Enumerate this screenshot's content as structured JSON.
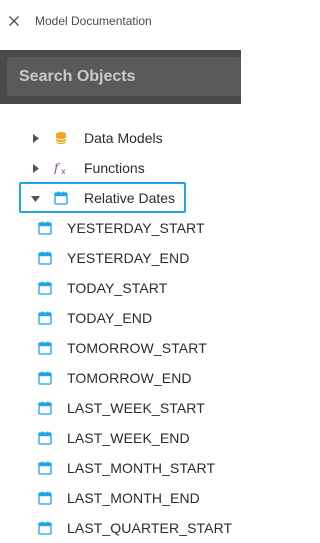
{
  "header": {
    "title": "Model Documentation",
    "close_icon": "close-icon"
  },
  "search": {
    "placeholder": "Search Objects",
    "value": ""
  },
  "tree": {
    "groups": [
      {
        "label": "Data Models",
        "icon": "database-icon",
        "icon_color": "#f0a21b",
        "expanded": false
      },
      {
        "label": "Functions",
        "icon": "function-icon",
        "icon_color": "#9b3aa0",
        "expanded": false
      },
      {
        "label": "Relative Dates",
        "icon": "calendar-icon",
        "icon_color": "#1ea4e8",
        "expanded": true,
        "selected": true
      }
    ],
    "relative_dates": [
      "YESTERDAY_START",
      "YESTERDAY_END",
      "TODAY_START",
      "TODAY_END",
      "TOMORROW_START",
      "TOMORROW_END",
      "LAST_WEEK_START",
      "LAST_WEEK_END",
      "LAST_MONTH_START",
      "LAST_MONTH_END",
      "LAST_QUARTER_START"
    ]
  },
  "colors": {
    "accent": "#1ea4e8",
    "search_bg": "#4a4a4a"
  }
}
